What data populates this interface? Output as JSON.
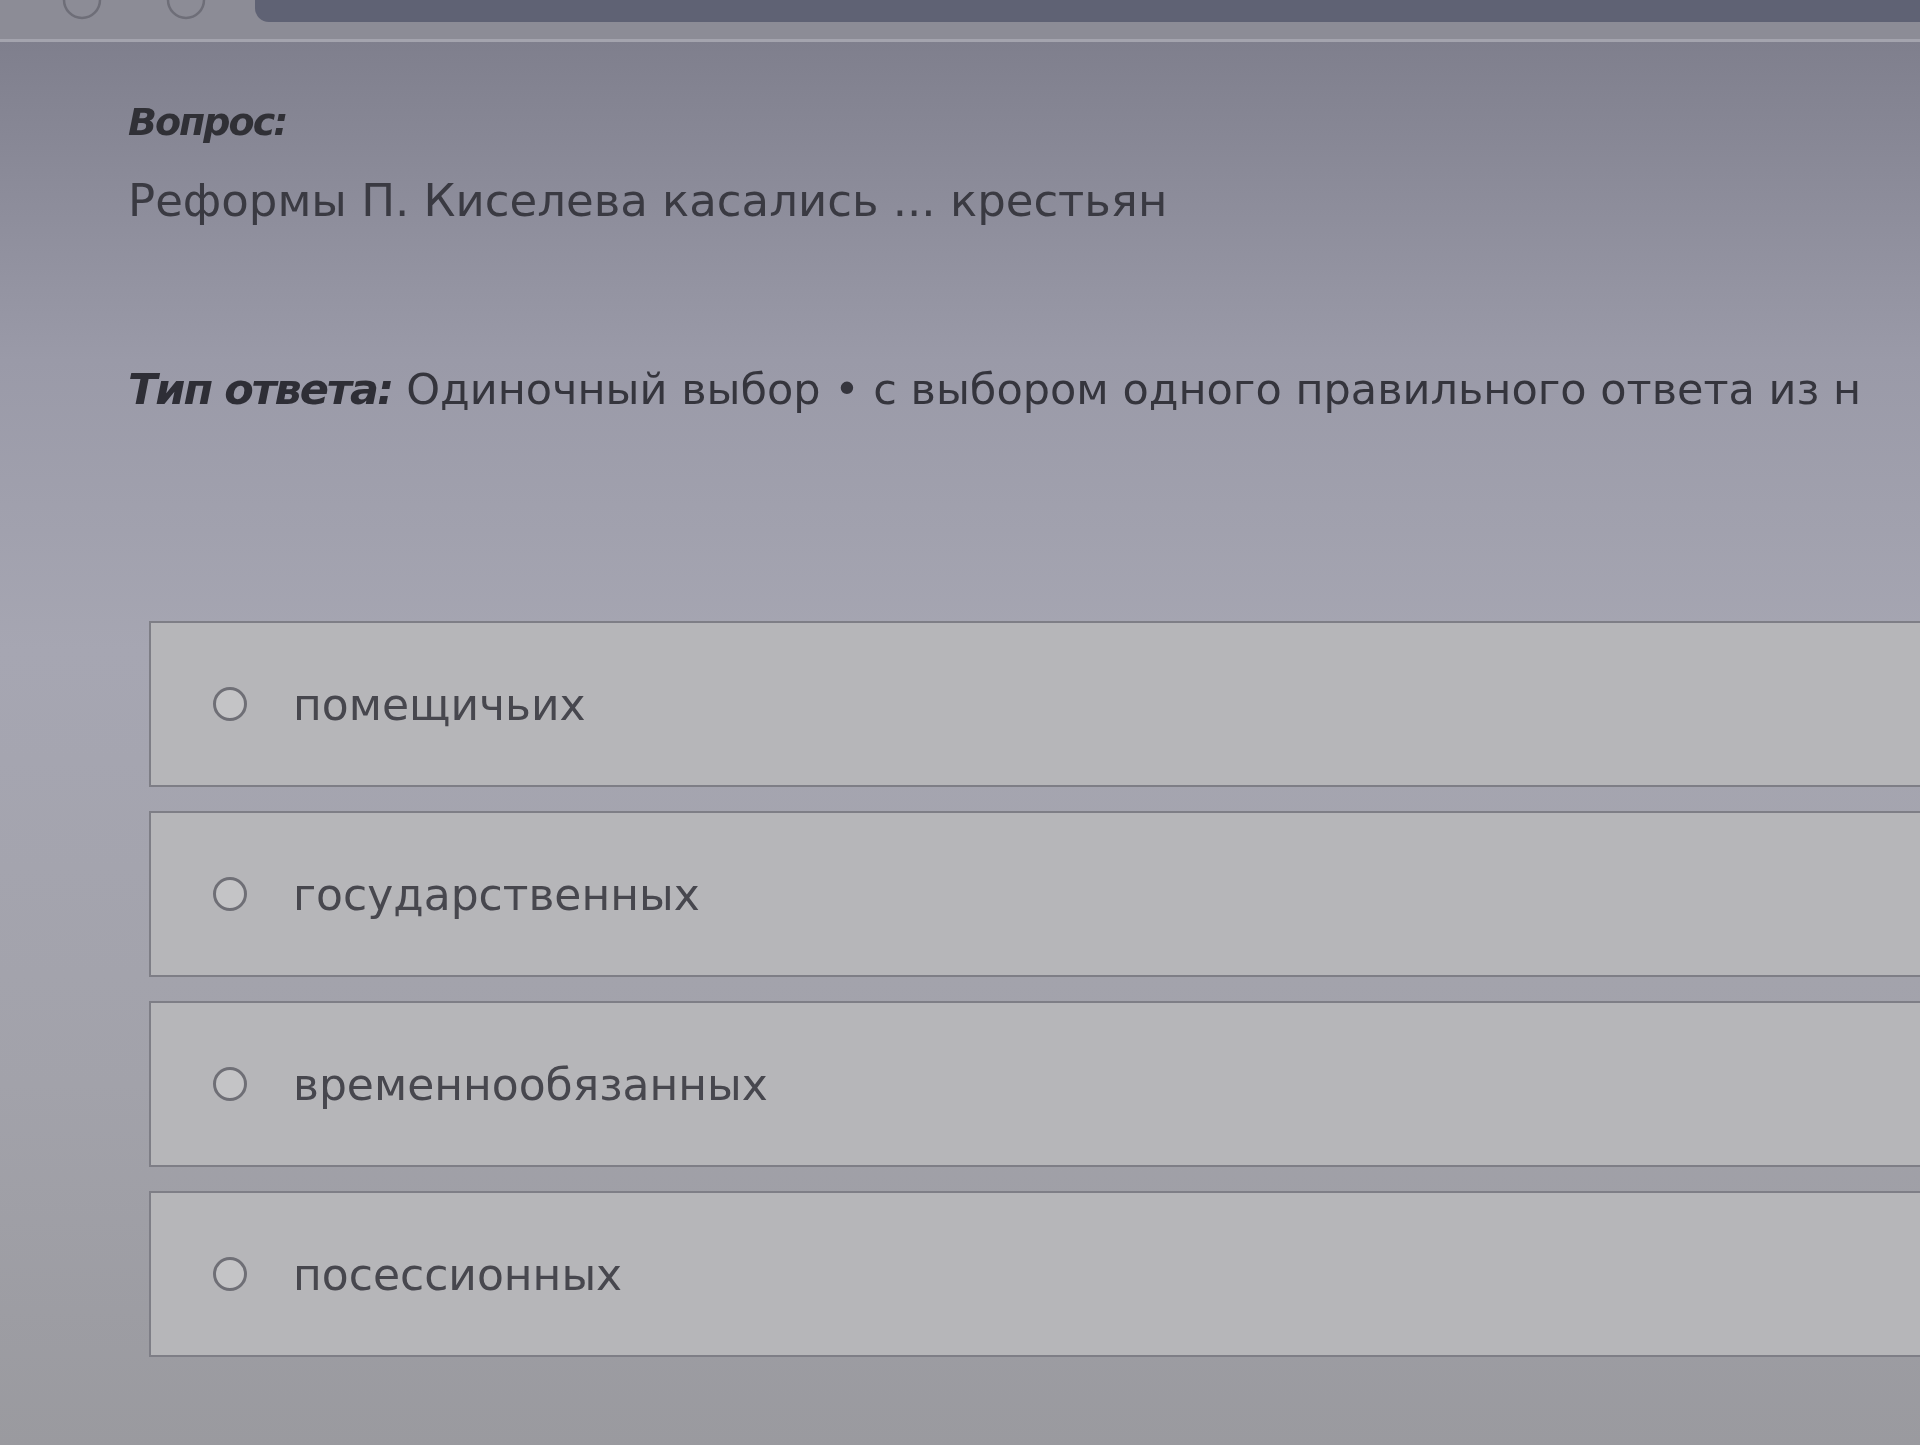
{
  "question": {
    "heading": "Вопрос:",
    "text": "Реформы П. Киселева касались ... крестьян"
  },
  "answer_type": {
    "label": "Тип ответа:",
    "value": "Одиночный выбор • с выбором одного правильного ответа из н"
  },
  "options": [
    {
      "label": "помещичьих",
      "selected": false
    },
    {
      "label": "государственных",
      "selected": false
    },
    {
      "label": "временнообязанных",
      "selected": false
    },
    {
      "label": "посессионных",
      "selected": false
    }
  ]
}
